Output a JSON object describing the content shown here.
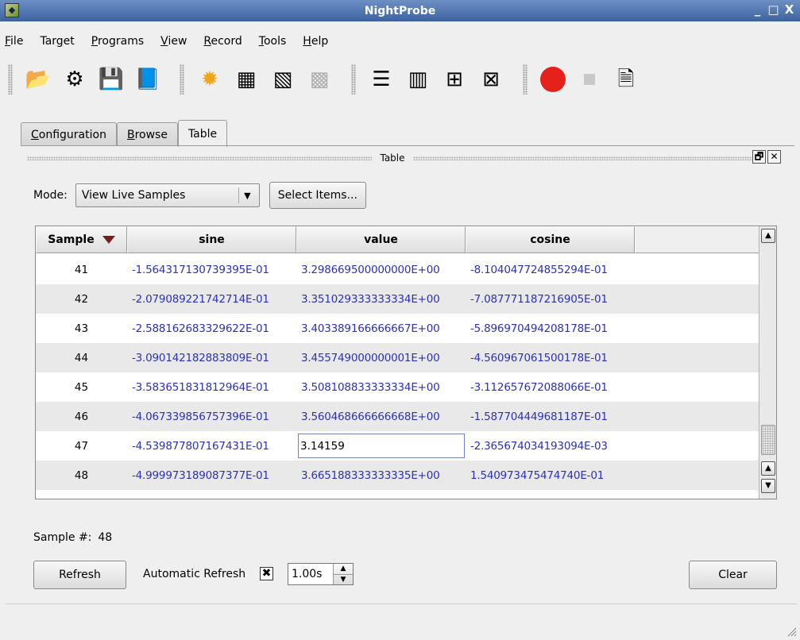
{
  "window": {
    "title": "NightProbe",
    "controls": [
      "_",
      "□",
      "X"
    ]
  },
  "menu": [
    "File",
    "Target",
    "Programs",
    "View",
    "Record",
    "Tools",
    "Help"
  ],
  "menu_mnemonics": [
    "F",
    "g",
    "P",
    "V",
    "R",
    "T",
    "H"
  ],
  "toolbar": {
    "icons": [
      "open-folder-icon",
      "configure-gear-icon",
      "save-disk-icon",
      "select-program-icon",
      "sun-icon",
      "chip-icon",
      "chip-arrow-icon",
      "chip-disabled-icon",
      "text-view-icon",
      "columns-view-icon",
      "table-view-icon",
      "graph-view-icon",
      "record-icon",
      "stop-icon",
      "report-icon"
    ]
  },
  "tabs": [
    {
      "label": "Configuration",
      "mnemonic": "C",
      "active": false
    },
    {
      "label": "Browse",
      "mnemonic": "B",
      "active": false
    },
    {
      "label": "Table",
      "active": true
    }
  ],
  "dock": {
    "title": "Table",
    "float_btn": "🗗",
    "close_btn": "✕"
  },
  "mode": {
    "label": "Mode:",
    "value": "View Live Samples",
    "select_items": "Select Items..."
  },
  "table": {
    "columns": [
      "Sample",
      "sine",
      "value",
      "cosine"
    ],
    "rows": [
      {
        "sample": "41",
        "sine": "-1.564317130739395E-01",
        "value": "3.298669500000000E+00",
        "cosine": "-8.104047724855294E-01"
      },
      {
        "sample": "42",
        "sine": "-2.079089221742714E-01",
        "value": "3.351029333333334E+00",
        "cosine": "-7.087771187216905E-01"
      },
      {
        "sample": "43",
        "sine": "-2.588162683329622E-01",
        "value": "3.403389166666667E+00",
        "cosine": "-5.896970494208178E-01"
      },
      {
        "sample": "44",
        "sine": "-3.090142182883809E-01",
        "value": "3.455749000000001E+00",
        "cosine": "-4.560967061500178E-01"
      },
      {
        "sample": "45",
        "sine": "-3.583651831812964E-01",
        "value": "3.508108833333334E+00",
        "cosine": "-3.112657672088066E-01"
      },
      {
        "sample": "46",
        "sine": "-4.067339856757396E-01",
        "value": "3.560468666666668E+00",
        "cosine": "-1.587704449681187E-01"
      },
      {
        "sample": "47",
        "sine": "-4.539877807167431E-01",
        "value": "3.14159",
        "cosine": "-2.365674034193094E-03",
        "editing": true
      },
      {
        "sample": "48",
        "sine": "-4.999973189087377E-01",
        "value": "3.665188333333335E+00",
        "cosine": "1.540973475474740E-01"
      }
    ]
  },
  "footer": {
    "sample_label": "Sample #:",
    "sample_value": "48",
    "refresh": "Refresh",
    "auto_refresh_label": "Automatic Refresh",
    "auto_refresh_checked": true,
    "interval": "1.00s",
    "clear": "Clear"
  },
  "colors": {
    "title_bar": "#3e62a0",
    "number_text": "#2b31b8",
    "record": "#e4221b",
    "sort_indicator": "#7a1d1d"
  }
}
